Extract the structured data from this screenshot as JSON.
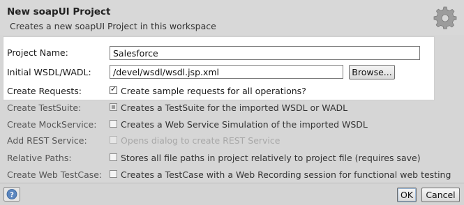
{
  "dialog": {
    "title": "New soapUI Project",
    "subtitle": "Creates a new soapUI Project in this workspace",
    "header_icon": "gear-icon"
  },
  "form": {
    "project_name": {
      "label": "Project Name:",
      "value": "Salesforce"
    },
    "wsdl": {
      "label": "Initial WSDL/WADL:",
      "value": "/devel/wsdl/wsdl.jsp.xml",
      "browse_label": "Browse..."
    },
    "create_requests": {
      "label": "Create Requests:",
      "text": "Create sample requests for all operations?",
      "checked": true
    },
    "create_testsuite": {
      "label": "Create TestSuite:",
      "text": "Creates a TestSuite for the imported WSDL or WADL",
      "checked": false
    },
    "create_mockservice": {
      "label": "Create MockService:",
      "text": "Creates a Web Service Simulation of the imported WSDL",
      "checked": false
    },
    "add_rest_service": {
      "label": "Add REST Service:",
      "text": "Opens dialog to create REST Service",
      "checked": false,
      "enabled": false
    },
    "relative_paths": {
      "label": "Relative Paths:",
      "text": "Stores all file paths in project relatively to project file (requires save)",
      "checked": false
    },
    "create_web_testcase": {
      "label": "Create Web TestCase:",
      "text": "Creates a TestCase with a Web Recording session for functional web testing",
      "checked": false
    }
  },
  "footer": {
    "help_icon": "help-icon",
    "ok_label": "OK",
    "cancel_label": "Cancel"
  },
  "colors": {
    "dialog_bg": "#d6d6d6",
    "panel_bg": "#ffffff",
    "help_icon_blue": "#4a78b0"
  }
}
